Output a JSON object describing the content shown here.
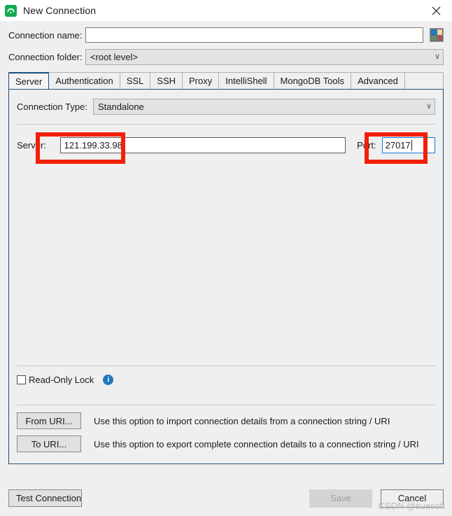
{
  "window": {
    "title": "New Connection",
    "icon": "mongodb-leaf-icon",
    "close_label": "✕",
    "accent": "#1f4e79",
    "icon_bg": "#13aa52"
  },
  "form": {
    "connection_name_label": "Connection name:",
    "connection_name_value": "",
    "connection_name_placeholder": "",
    "color_swatch": {
      "name": "color-swatch-button",
      "colors": [
        "#1b7fc4",
        "#f0d5a8",
        "#5f8f6f",
        "#a85558"
      ]
    },
    "connection_folder_label": "Connection folder:",
    "connection_folder_value": "<root level>",
    "chevron": "∨"
  },
  "tabs": [
    {
      "label": "Server",
      "active": true
    },
    {
      "label": "Authentication",
      "active": false
    },
    {
      "label": "SSL",
      "active": false
    },
    {
      "label": "SSH",
      "active": false
    },
    {
      "label": "Proxy",
      "active": false
    },
    {
      "label": "IntelliShell",
      "active": false
    },
    {
      "label": "MongoDB Tools",
      "active": false
    },
    {
      "label": "Advanced",
      "active": false
    }
  ],
  "server_tab": {
    "connection_type_label": "Connection Type:",
    "connection_type_value": "Standalone",
    "connection_type_chevron": "∨",
    "server_label": "Server:",
    "server_value": "121.199.33.98",
    "port_label": "Port:",
    "port_value": "27017",
    "readonly_label": "Read-Only Lock",
    "readonly_checked": false,
    "info_icon_glyph": "i",
    "from_uri_button": "From URI...",
    "from_uri_desc": "Use this option to import connection details from a connection string / URI",
    "to_uri_button": "To URI...",
    "to_uri_desc": "Use this option to export complete connection details to a connection string / URI"
  },
  "footer": {
    "test_connection_label": "Test Connection",
    "save_label": "Save",
    "save_enabled": false,
    "cancel_label": "Cancel"
  },
  "annotations": {
    "color": "#f41f08",
    "boxes": [
      "server-field-highlight",
      "port-field-highlight"
    ]
  },
  "watermark": "CSDN @suesoft"
}
